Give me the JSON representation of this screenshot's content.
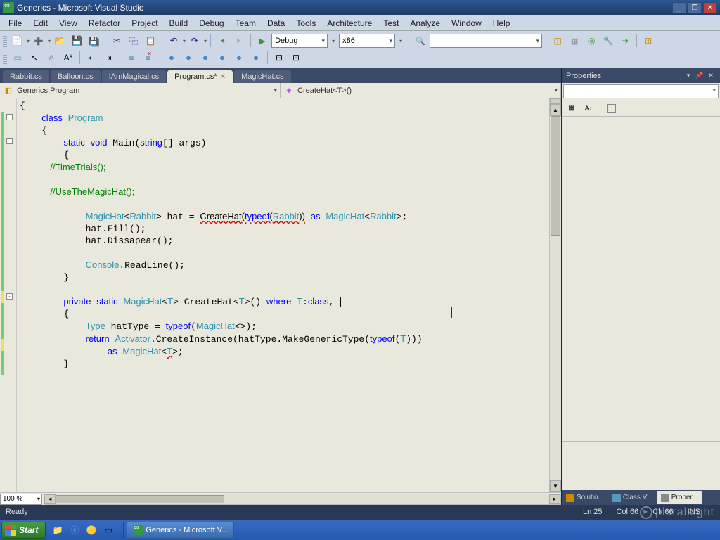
{
  "titlebar": {
    "title": "Generics - Microsoft Visual Studio"
  },
  "menus": [
    "File",
    "Edit",
    "View",
    "Refactor",
    "Project",
    "Build",
    "Debug",
    "Team",
    "Data",
    "Tools",
    "Architecture",
    "Test",
    "Analyze",
    "Window",
    "Help"
  ],
  "toolbar1": {
    "config_combo": "Debug",
    "platform_combo": "x86",
    "find_combo": ""
  },
  "tabs": [
    {
      "label": "Rabbit.cs",
      "active": false,
      "dirty": false
    },
    {
      "label": "Balloon.cs",
      "active": false,
      "dirty": false
    },
    {
      "label": "IAmMagical.cs",
      "active": false,
      "dirty": false
    },
    {
      "label": "Program.cs*",
      "active": true,
      "dirty": true
    },
    {
      "label": "MagicHat.cs",
      "active": false,
      "dirty": false
    }
  ],
  "nav": {
    "left": "Generics.Program",
    "right": "CreateHat<T>()"
  },
  "code_lines": [
    "{",
    "    class Program",
    "    {",
    "        static void Main(string[] args)",
    "        {",
    "            //TimeTrials();",
    "",
    "            //UseTheMagicHat();",
    "",
    "            MagicHat<Rabbit> hat = CreateHat(typeof(Rabbit)) as MagicHat<Rabbit>;",
    "            hat.Fill();",
    "            hat.Dissapear();",
    "",
    "            Console.ReadLine();",
    "        }",
    "",
    "        private static MagicHat<T> CreateHat<T>() where T:class, ",
    "        {",
    "            Type hatType = typeof(MagicHat<>);",
    "            return Activator.CreateInstance(hatType.MakeGenericType(typeof(T)))",
    "                as MagicHat<T>;",
    "        }",
    ""
  ],
  "zoom": "100 %",
  "properties": {
    "title": "Properties"
  },
  "panel_tabs": [
    {
      "label": "Solutio...",
      "active": false
    },
    {
      "label": "Class V...",
      "active": false
    },
    {
      "label": "Proper...",
      "active": true
    }
  ],
  "status": {
    "ready": "Ready",
    "ln": "Ln 25",
    "col": "Col 66",
    "ch": "Ch 66",
    "ins": "INS"
  },
  "taskbar": {
    "start": "Start",
    "app_task": "Generics - Microsoft V..."
  },
  "watermark": "pluralsight"
}
